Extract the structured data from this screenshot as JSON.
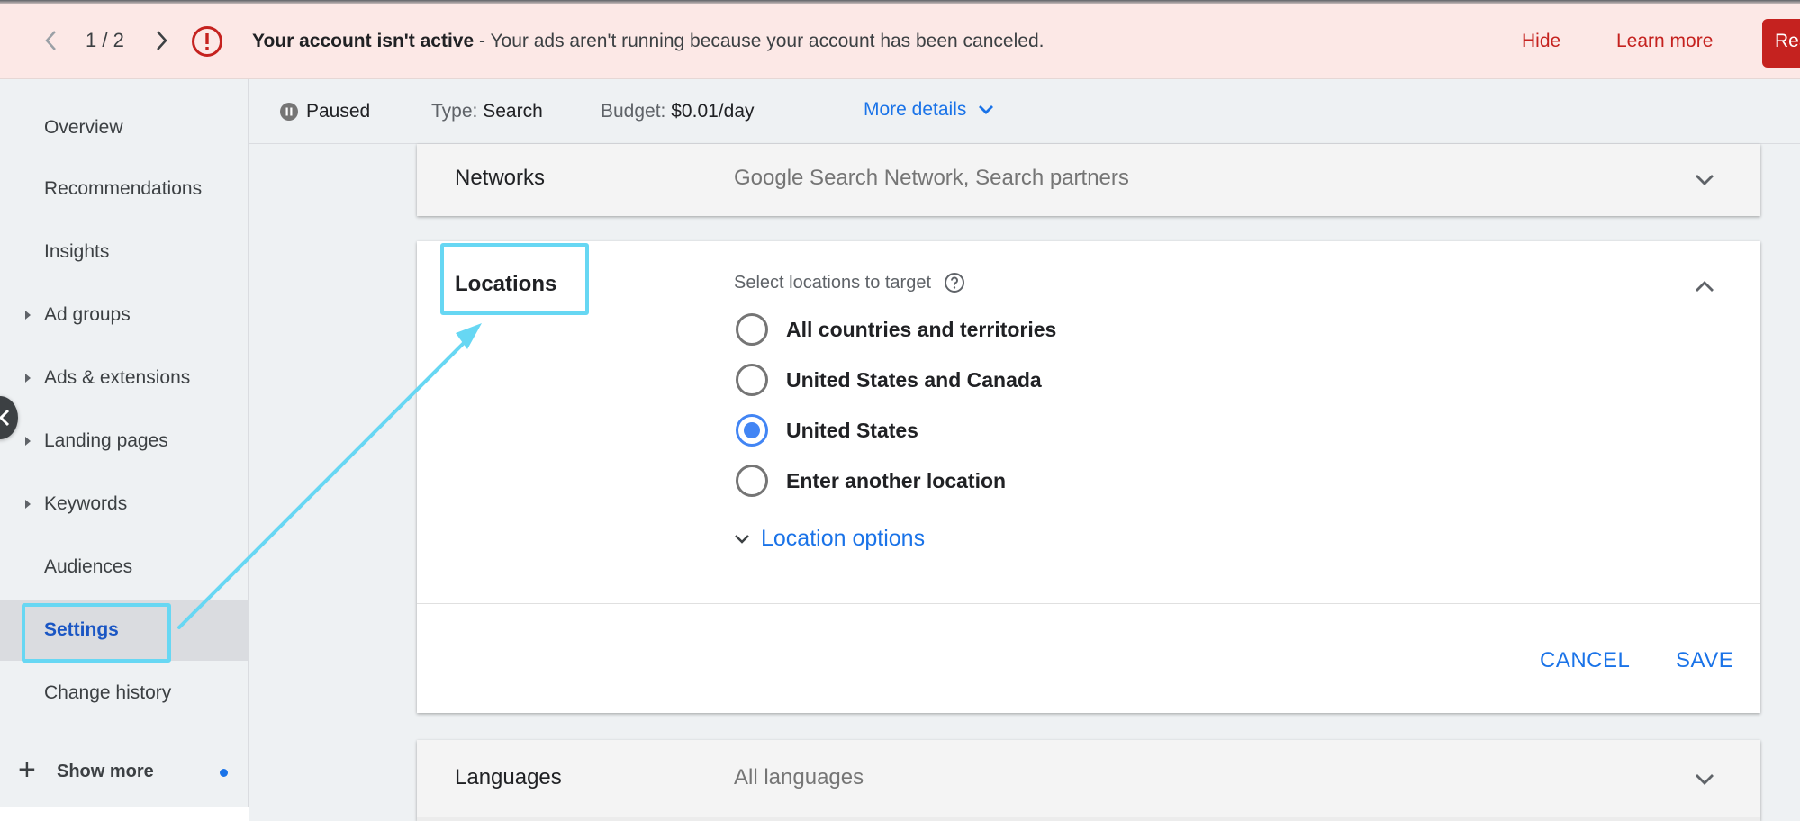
{
  "banner": {
    "pager": "1 / 2",
    "title": "Your account isn't active",
    "message": " - Your ads aren't running because your account has been canceled.",
    "hide_label": "Hide",
    "learn_more_label": "Learn more",
    "action_label": "Reactivate",
    "colors": {
      "background": "#fce8e6",
      "accent": "#c5221f"
    }
  },
  "sidebar": {
    "items": [
      {
        "label": "Overview",
        "expandable": false,
        "active": false
      },
      {
        "label": "Recommendations",
        "expandable": false,
        "active": false
      },
      {
        "label": "Insights",
        "expandable": false,
        "active": false
      },
      {
        "label": "Ad groups",
        "expandable": true,
        "active": false
      },
      {
        "label": "Ads & extensions",
        "expandable": true,
        "active": false
      },
      {
        "label": "Landing pages",
        "expandable": true,
        "active": false
      },
      {
        "label": "Keywords",
        "expandable": true,
        "active": false
      },
      {
        "label": "Audiences",
        "expandable": false,
        "active": false
      },
      {
        "label": "Settings",
        "expandable": false,
        "active": true
      },
      {
        "label": "Change history",
        "expandable": false,
        "active": false
      }
    ],
    "show_more_label": "Show more"
  },
  "statusbar": {
    "status": "Paused",
    "type_label": "Type:",
    "type_value": "Search",
    "budget_label": "Budget:",
    "budget_value": "$0.01/day",
    "more_details_label": "More details"
  },
  "settings": {
    "networks": {
      "title": "Networks",
      "value": "Google Search Network, Search partners"
    },
    "locations": {
      "title": "Locations",
      "subtitle": "Select locations to target",
      "options": [
        {
          "label": "All countries and territories",
          "selected": false
        },
        {
          "label": "United States and Canada",
          "selected": false
        },
        {
          "label": "United States",
          "selected": true
        },
        {
          "label": "Enter another location",
          "selected": false
        }
      ],
      "location_options_label": "Location options",
      "cancel_label": "CANCEL",
      "save_label": "SAVE"
    },
    "languages": {
      "title": "Languages",
      "value": "All languages"
    }
  },
  "annotation": {
    "color": "#67d7f3"
  }
}
